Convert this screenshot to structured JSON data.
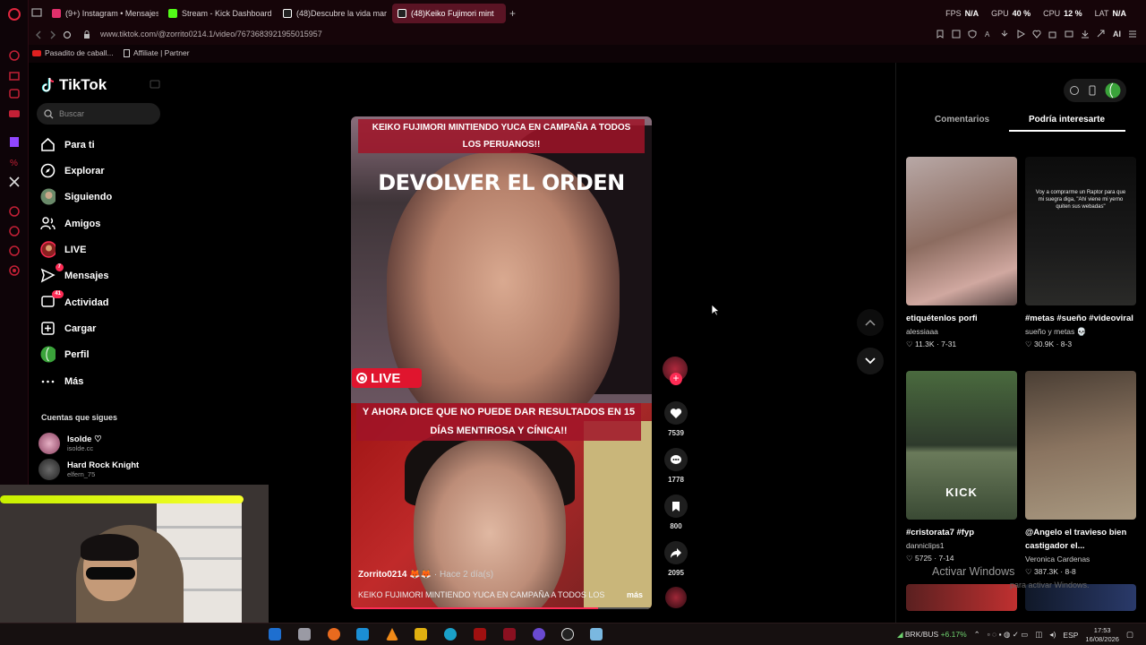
{
  "browser": {
    "tabs": [
      {
        "label": "(9+) Instagram • Mensajes",
        "color": "#e1306c"
      },
      {
        "label": "Stream - Kick Dashboard",
        "color": "#53fc18"
      },
      {
        "label": "(48)Descubre la vida marin",
        "color": "#ffffff"
      },
      {
        "label": "(48)Keiko Fujimori mint",
        "color": "#ffffff"
      }
    ],
    "new_tab": "+",
    "perf": [
      {
        "label": "FPS",
        "value": "N/A"
      },
      {
        "label": "GPU",
        "value": "40 %"
      },
      {
        "label": "CPU",
        "value": "12 %"
      },
      {
        "label": "LAT",
        "value": "N/A"
      }
    ],
    "url": "www.tiktok.com/@zorrito0214.1/video/7673683921955015957",
    "ai_label": "AI",
    "bookmarks": [
      "Pasadito de caball...",
      "Affiliate | Partner"
    ]
  },
  "tiktok": {
    "logo": "TikTok",
    "search_placeholder": "Buscar",
    "nav": [
      {
        "label": "Para ti",
        "icon": "home-icon"
      },
      {
        "label": "Explorar",
        "icon": "compass-icon"
      },
      {
        "label": "Siguiendo",
        "icon": "following-avatar-icon"
      },
      {
        "label": "Amigos",
        "icon": "friends-icon"
      },
      {
        "label": "LIVE",
        "icon": "live-avatar-icon"
      },
      {
        "label": "Mensajes",
        "icon": "messages-icon",
        "badge": "7"
      },
      {
        "label": "Actividad",
        "icon": "activity-icon",
        "badge": "41"
      },
      {
        "label": "Cargar",
        "icon": "upload-icon"
      },
      {
        "label": "Perfil",
        "icon": "profile-avatar-icon"
      },
      {
        "label": "Más",
        "icon": "more-icon"
      }
    ],
    "following_heading": "Cuentas que sigues",
    "following": [
      {
        "name": "Isolde ♡",
        "handle": "isolde.cc"
      },
      {
        "name": "Hard Rock Knight",
        "handle": "elfern_75"
      }
    ],
    "video": {
      "caption_top": "KEIKO FUJIMORI  MINTIENDO YUCA EN CAMPAÑA A TODOS LOS PERUANOS!!",
      "big_text": "DEVOLVER EL ORDEN",
      "live_label": "LIVE",
      "caption_mid": "Y AHORA DICE QUE NO PUEDE DAR RESULTADOS EN 15 DÍAS MENTIROSA Y CÍNICA!!",
      "author": "Zorrito0214 🦊🦊",
      "time": " · Hace 2 día(s)",
      "description": "KEIKO FUJIMORI  MINTIENDO YUCA EN CAMPAÑA A TODOS LOS",
      "more": "más"
    },
    "actions": {
      "likes": "7539",
      "comments": "1778",
      "saves": "800",
      "shares": "2095"
    },
    "right_tabs": [
      "Comentarios",
      "Podría interesarte"
    ],
    "recommended": [
      {
        "title": "etiquétenlos porfi",
        "author": "alessiaaa",
        "likes": "11.3K",
        "date": "7-31",
        "thumb_text": ""
      },
      {
        "title": "#metas #sueño #videoviral",
        "author": "sueño y metas 💀",
        "likes": "30.9K",
        "date": "8-3",
        "thumb_text": "Voy a comprarme un Raptor para que mi suegra diga, \"Ahí viene mi yerno quiten sus webadas\""
      },
      {
        "title": "#cristorata7 #fyp",
        "author": "danniclips1",
        "likes": "5725",
        "date": "7-14",
        "thumb_text": "KICK"
      },
      {
        "title": "@Angelo el travieso bien castigador el...",
        "author": "Veronica Cardenas",
        "likes": "387.3K",
        "date": "8-8",
        "thumb_text": ""
      }
    ]
  },
  "windows_overlay": {
    "line1": "Activar Windows",
    "line2": "para activar Windows."
  },
  "taskbar": {
    "stock": "BRK/BUS",
    "stock_change": "+6.17%",
    "lang": "ESP",
    "time": "17:53",
    "date": "16/08/2026"
  }
}
